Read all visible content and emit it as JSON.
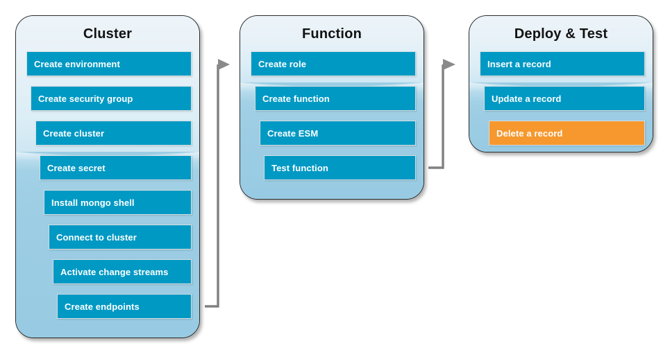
{
  "diagram": {
    "title_visible": false,
    "background": "#ffffff",
    "accent_blue": "#0099c4",
    "accent_orange": "#f6982d",
    "panel_top_color": "#eaf3f9",
    "panel_bottom_color": "#9bcde4",
    "connector_color": "#808080"
  },
  "panels": [
    {
      "id": "cluster",
      "title": "Cluster",
      "steps": [
        {
          "label": "Create environment",
          "state": "normal"
        },
        {
          "label": "Create security group",
          "state": "normal"
        },
        {
          "label": "Create cluster",
          "state": "normal"
        },
        {
          "label": "Create secret",
          "state": "normal"
        },
        {
          "label": "Install mongo shell",
          "state": "normal"
        },
        {
          "label": "Connect to cluster",
          "state": "normal"
        },
        {
          "label": "Activate change streams",
          "state": "normal"
        },
        {
          "label": "Create endpoints",
          "state": "normal"
        }
      ]
    },
    {
      "id": "function",
      "title": "Function",
      "steps": [
        {
          "label": "Create role",
          "state": "normal"
        },
        {
          "label": "Create function",
          "state": "normal"
        },
        {
          "label": "Create ESM",
          "state": "normal"
        },
        {
          "label": "Test function",
          "state": "normal"
        }
      ]
    },
    {
      "id": "deploy-test",
      "title": "Deploy & Test",
      "steps": [
        {
          "label": "Insert a record",
          "state": "normal"
        },
        {
          "label": "Update a record",
          "state": "normal"
        },
        {
          "label": "Delete a record",
          "state": "highlight"
        }
      ]
    }
  ],
  "connectors": [
    {
      "id": "cluster-to-function",
      "from": "Create endpoints",
      "to": "Create role",
      "shape": "elbow-up-right"
    },
    {
      "id": "function-to-deploy",
      "from": "Test function",
      "to": "Insert a record",
      "shape": "elbow-up-right"
    }
  ]
}
